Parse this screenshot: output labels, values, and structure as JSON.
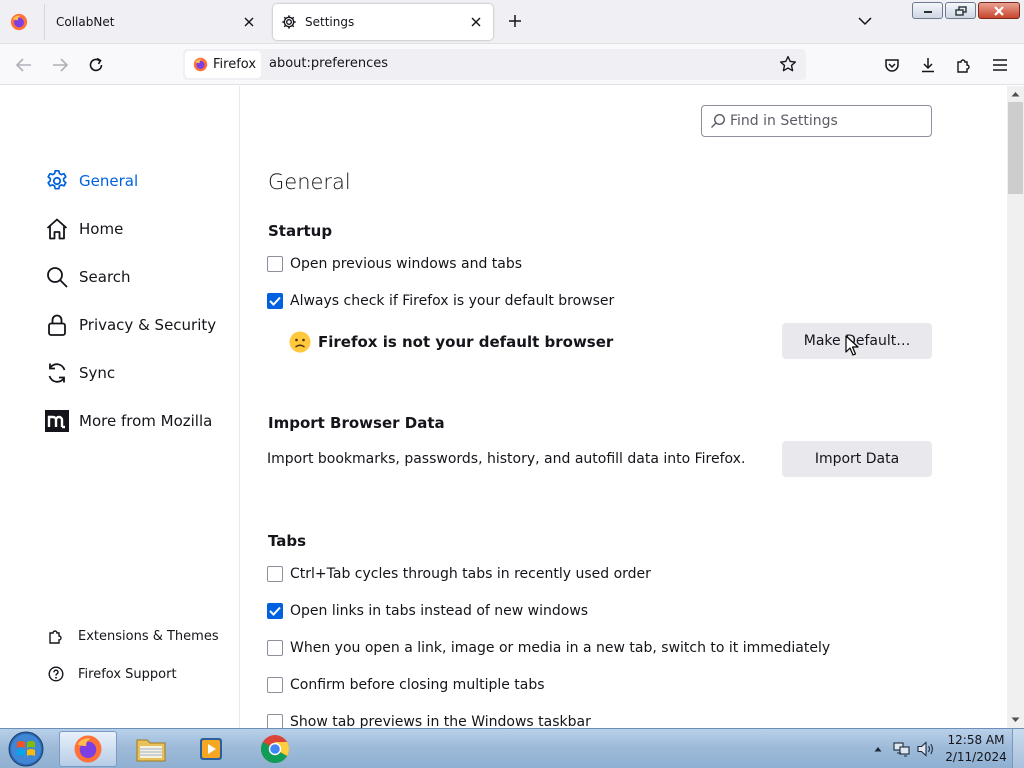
{
  "tabs": [
    {
      "title": "CollabNet",
      "active": false
    },
    {
      "title": "Settings",
      "active": true
    }
  ],
  "navbar": {
    "identity_label": "Firefox",
    "url": "about:preferences"
  },
  "sidebar": {
    "categories": [
      {
        "label": "General",
        "icon": "gear-icon",
        "selected": true
      },
      {
        "label": "Home",
        "icon": "home-icon",
        "selected": false
      },
      {
        "label": "Search",
        "icon": "search-icon",
        "selected": false
      },
      {
        "label": "Privacy & Security",
        "icon": "lock-icon",
        "selected": false
      },
      {
        "label": "Sync",
        "icon": "sync-icon",
        "selected": false
      },
      {
        "label": "More from Mozilla",
        "icon": "mozilla-icon",
        "selected": false
      }
    ],
    "footer": [
      {
        "label": "Extensions & Themes",
        "icon": "puzzle-icon"
      },
      {
        "label": "Firefox Support",
        "icon": "help-icon"
      }
    ]
  },
  "content": {
    "search_placeholder": "Find in Settings",
    "page_title": "General",
    "startup": {
      "heading": "Startup",
      "open_previous": {
        "label": "Open previous windows and tabs",
        "checked": false
      },
      "always_check": {
        "label": "Always check if Firefox is your default browser",
        "checked": true
      },
      "default_status": "Firefox is not your default browser",
      "make_default_button": "Make Default…"
    },
    "import": {
      "heading": "Import Browser Data",
      "description": "Import bookmarks, passwords, history, and autofill data into Firefox.",
      "button": "Import Data"
    },
    "tabs_section": {
      "heading": "Tabs",
      "options": [
        {
          "label": "Ctrl+Tab cycles through tabs in recently used order",
          "checked": false
        },
        {
          "label": "Open links in tabs instead of new windows",
          "checked": true
        },
        {
          "label": "When you open a link, image or media in a new tab, switch to it immediately",
          "checked": false
        },
        {
          "label": "Confirm before closing multiple tabs",
          "checked": false
        },
        {
          "label": "Show tab previews in the Windows taskbar",
          "checked": false
        }
      ]
    }
  },
  "taskbar": {
    "clock_time": "12:58 AM",
    "clock_date": "2/11/2024"
  },
  "colors": {
    "accent": "#0061e0",
    "tabstrip_bg": "#f0f0f4",
    "taskbar_bg": "#9ebbd9"
  }
}
